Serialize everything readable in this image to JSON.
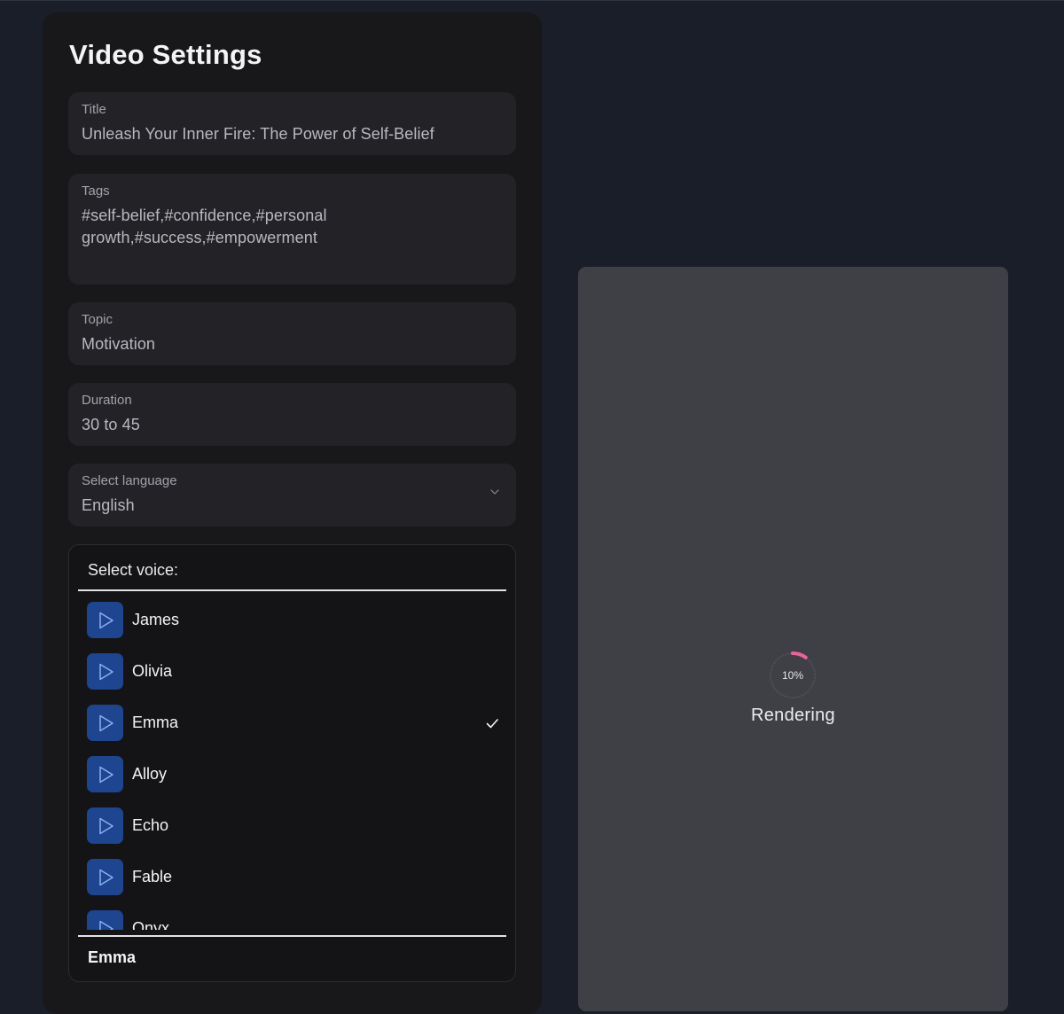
{
  "panel": {
    "heading": "Video Settings"
  },
  "fields": {
    "title": {
      "label": "Title",
      "value": "Unleash Your Inner Fire: The Power of Self-Belief"
    },
    "tags": {
      "label": "Tags",
      "value": "#self-belief,#confidence,#personal growth,#success,#empowerment"
    },
    "topic": {
      "label": "Topic",
      "value": "Motivation"
    },
    "duration": {
      "label": "Duration",
      "value": "30 to 45"
    },
    "language": {
      "label": "Select language",
      "value": "English",
      "icon": "chevron-down-icon"
    }
  },
  "voice": {
    "title": "Select voice:",
    "items": [
      {
        "name": "James",
        "selected": false
      },
      {
        "name": "Olivia",
        "selected": false
      },
      {
        "name": "Emma",
        "selected": true
      },
      {
        "name": "Alloy",
        "selected": false
      },
      {
        "name": "Echo",
        "selected": false
      },
      {
        "name": "Fable",
        "selected": false
      },
      {
        "name": "Onyx",
        "selected": false
      }
    ],
    "selected_label": "Emma",
    "play_icon": "play-icon",
    "check_icon": "check-icon"
  },
  "preview": {
    "progress_text": "10%",
    "progress_fraction": 0.1,
    "status": "Rendering"
  },
  "colors": {
    "page_bg": "#1a1e29",
    "panel_bg": "#18181b",
    "field_bg": "#232327",
    "play_button": "#1d4590",
    "preview_bg": "#3f4046",
    "spinner_accent": "#f0609a"
  }
}
